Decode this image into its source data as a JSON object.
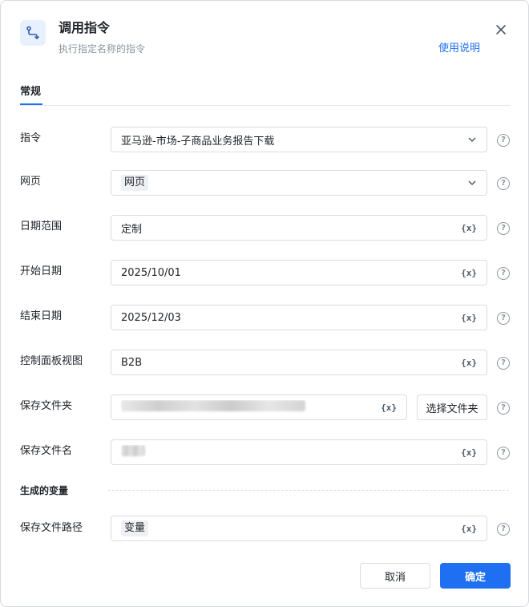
{
  "dialog": {
    "title": "调用指令",
    "subtitle": "执行指定名称的指令",
    "help_link": "使用说明",
    "icon": "flow-icon"
  },
  "tabs": [
    {
      "label": "常规",
      "active": true
    }
  ],
  "fields": {
    "command": {
      "label": "指令",
      "value": "亚马逊-市场-子商品业务报告下载"
    },
    "webpage": {
      "label": "网页",
      "value": "网页"
    },
    "date_range": {
      "label": "日期范围",
      "value": "定制"
    },
    "start_date": {
      "label": "开始日期",
      "value": "2025/10/01"
    },
    "end_date": {
      "label": "结束日期",
      "value": "2025/12/03"
    },
    "dashboard_view": {
      "label": "控制面板视图",
      "value": "B2B"
    },
    "save_folder": {
      "label": "保存文件夹",
      "button": "选择文件夹"
    },
    "save_filename": {
      "label": "保存文件名"
    }
  },
  "output_section": {
    "title": "生成的变量",
    "save_path": {
      "label": "保存文件路径",
      "value": "变量"
    }
  },
  "variable_button": "{x}",
  "help_icon": "?",
  "footer": {
    "cancel": "取消",
    "ok": "确定"
  },
  "colors": {
    "accent": "#1e6ff1"
  }
}
